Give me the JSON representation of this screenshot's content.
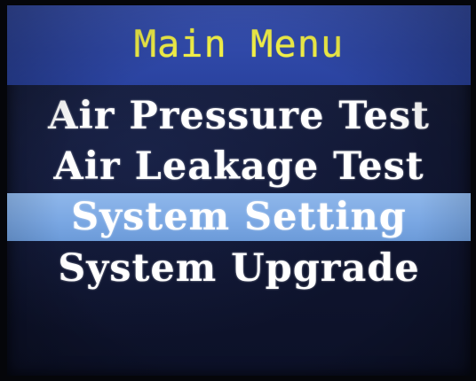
{
  "header": {
    "title": "Main Menu"
  },
  "menu": {
    "items": [
      {
        "label": "Air Pressure Test"
      },
      {
        "label": "Air Leakage Test"
      },
      {
        "label": "System Setting"
      },
      {
        "label": "System Upgrade"
      }
    ],
    "selected_index": 2
  },
  "colors": {
    "header_bg": "#3049a8",
    "title_text": "#f1ef48",
    "item_text": "#ffffff",
    "selection_bg": "#7aa7e3",
    "screen_bg": "#111733"
  }
}
